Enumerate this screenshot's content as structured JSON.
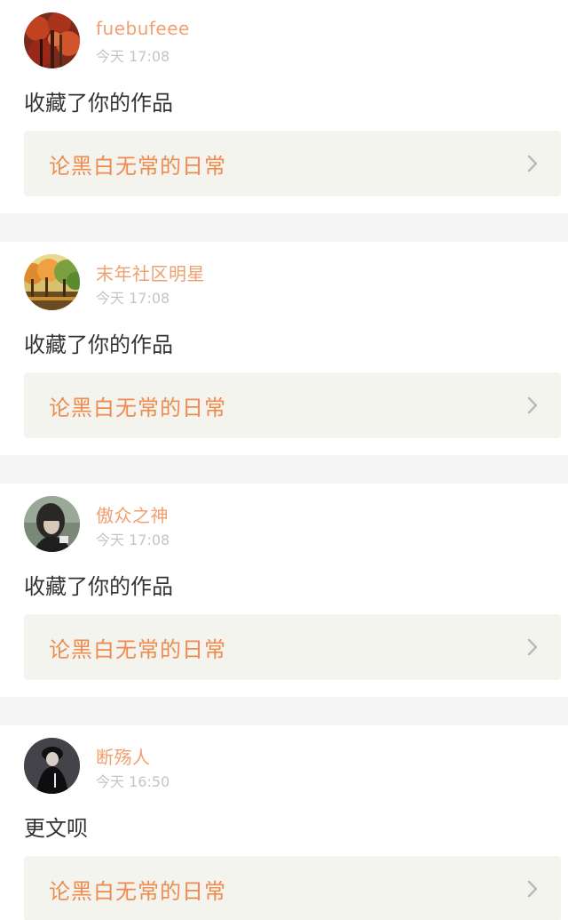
{
  "notifications": [
    {
      "username": "fuebufeee",
      "time": "今天 17:08",
      "message": "收藏了你的作品",
      "work_title": "论黑白无常的日常",
      "avatar_icon": "autumn-tree-icon"
    },
    {
      "username": "末年社区明星",
      "time": "今天 17:08",
      "message": "收藏了你的作品",
      "work_title": "论黑白无常的日常",
      "avatar_icon": "autumn-forest-icon"
    },
    {
      "username": "傲众之神",
      "time": "今天 17:08",
      "message": "收藏了你的作品",
      "work_title": "论黑白无常的日常",
      "avatar_icon": "portrait-girl-icon"
    },
    {
      "username": "断殇人",
      "time": "今天 16:50",
      "message": "更文呗",
      "work_title": "论黑白无常的日常",
      "avatar_icon": "dark-figure-icon"
    }
  ],
  "colors": {
    "username": "#f0a070",
    "work_title": "#f08a4f",
    "link_bg": "#f4f4ee",
    "separator": "#f5f5f5"
  }
}
